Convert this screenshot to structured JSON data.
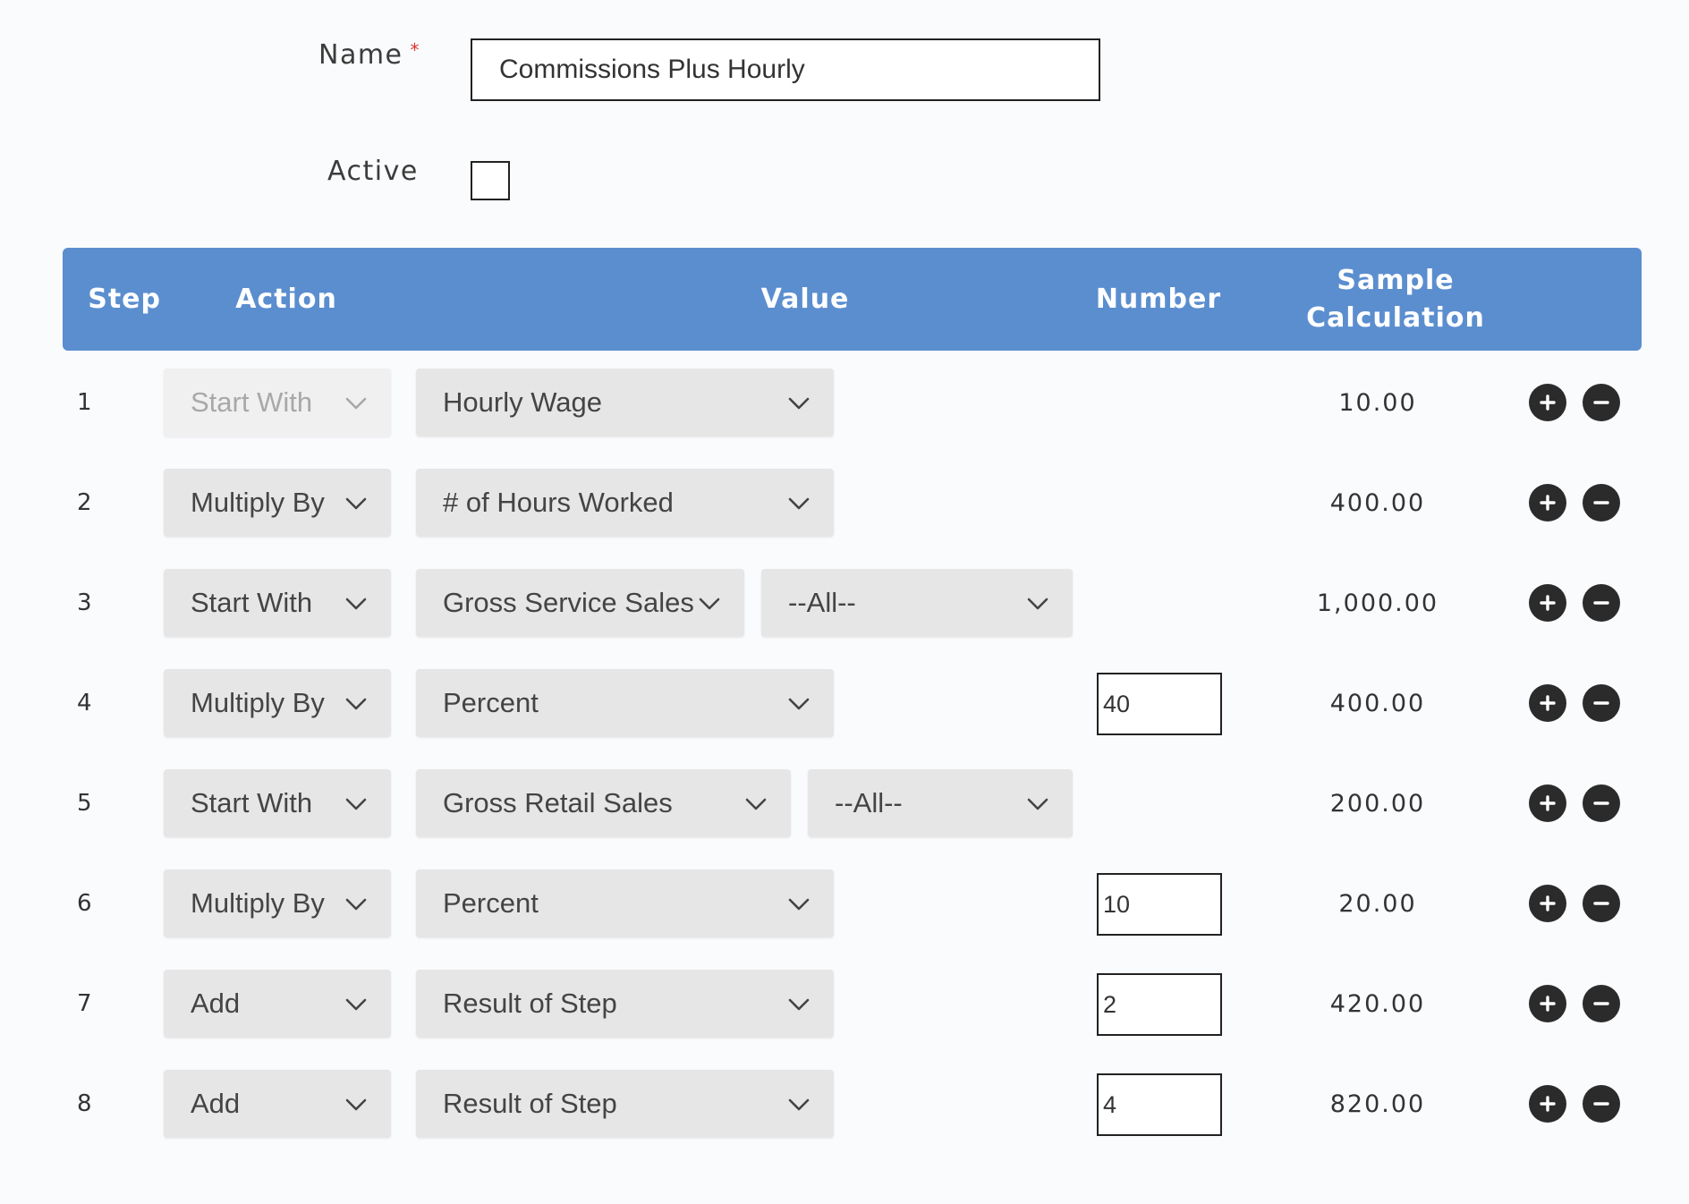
{
  "form": {
    "name_label": "Name",
    "required_marker": "*",
    "name_value": "Commissions Plus Hourly",
    "active_label": "Active"
  },
  "table": {
    "headers": {
      "step": "Step",
      "action": "Action",
      "value": "Value",
      "number": "Number",
      "sample_line1": "Sample",
      "sample_line2": "Calculation"
    },
    "rows": [
      {
        "step": "1",
        "action": "Start With",
        "value": "Hourly Wage",
        "sub": "",
        "number": "",
        "calc": "10.00"
      },
      {
        "step": "2",
        "action": "Multiply By",
        "value": "# of Hours Worked",
        "sub": "",
        "number": "",
        "calc": "400.00"
      },
      {
        "step": "3",
        "action": "Start With",
        "value": "Gross Service Sales",
        "sub": "--All--",
        "number": "",
        "calc": "1,000.00"
      },
      {
        "step": "4",
        "action": "Multiply By",
        "value": "Percent",
        "sub": "",
        "number": "40",
        "calc": "400.00"
      },
      {
        "step": "5",
        "action": "Start With",
        "value": "Gross Retail Sales",
        "sub": "--All--",
        "number": "",
        "calc": "200.00"
      },
      {
        "step": "6",
        "action": "Multiply By",
        "value": "Percent",
        "sub": "",
        "number": "10",
        "calc": "20.00"
      },
      {
        "step": "7",
        "action": "Add",
        "value": "Result of Step",
        "sub": "",
        "number": "2",
        "calc": "420.00"
      },
      {
        "step": "8",
        "action": "Add",
        "value": "Result of Step",
        "sub": "",
        "number": "4",
        "calc": "820.00"
      }
    ]
  },
  "colors": {
    "header_bg": "#5b8ecf",
    "select_bg": "#e6e6e6",
    "button_bg": "#2b2b2b"
  },
  "icons": {
    "select_arrow": "chevron-down-icon",
    "add": "plus-circle-icon",
    "remove": "minus-circle-icon"
  }
}
